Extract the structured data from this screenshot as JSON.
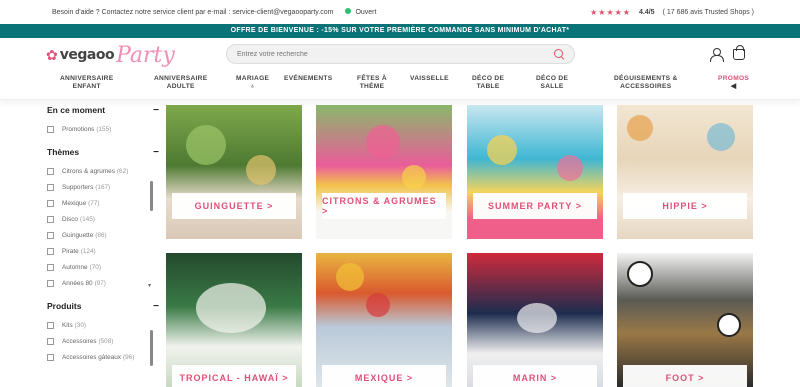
{
  "topbar": {
    "help_text": "Besoin d'aide ? Contactez notre service client par e-mail : service-client@vegaooparty.com",
    "status": "Ouvert",
    "stars": "★★★★★",
    "rating": "4.4/5",
    "rating_detail": "( 17 686 avis Trusted Shops )"
  },
  "promo_banner": "OFFRE DE BIENVENUE : -15% SUR VOTRE PREMIÈRE COMMANDE SANS MINIMUM D'ACHAT*",
  "logo": {
    "flower": "✿",
    "part1": "vegaoo",
    "part2": "Party"
  },
  "search": {
    "placeholder": "Entrez votre recherche"
  },
  "nav": [
    {
      "label": "ANNIVERSAIRE\nENFANT"
    },
    {
      "label": "ANNIVERSAIRE\nADULTE"
    },
    {
      "label": "MARIAGE"
    },
    {
      "label": "EVÉNEMENTS"
    },
    {
      "label": "FÊTES À\nTHÈME"
    },
    {
      "label": "VAISSELLE"
    },
    {
      "label": "DÉCO DE\nTABLE"
    },
    {
      "label": "DÉCO DE\nSALLE"
    },
    {
      "label": "DÉGUISEMENTS &\nACCESSOIRES"
    },
    {
      "label": "PROMOS"
    }
  ],
  "sidebar": {
    "sections": [
      {
        "title": "En ce moment",
        "items": [
          {
            "label": "Promotions",
            "count": "(155)"
          }
        ]
      },
      {
        "title": "Thèmes",
        "items": [
          {
            "label": "Citrons & agrumes",
            "count": "(62)"
          },
          {
            "label": "Supporters",
            "count": "(167)"
          },
          {
            "label": "Mexique",
            "count": "(77)"
          },
          {
            "label": "Disco",
            "count": "(145)"
          },
          {
            "label": "Guinguette",
            "count": "(86)"
          },
          {
            "label": "Pirate",
            "count": "(124)"
          },
          {
            "label": "Automne",
            "count": "(70)"
          },
          {
            "label": "Années 80",
            "count": "(97)"
          }
        ]
      },
      {
        "title": "Produits",
        "items": [
          {
            "label": "Kits",
            "count": "(30)"
          },
          {
            "label": "Accessoires",
            "count": "(508)"
          },
          {
            "label": "Accessoires gâteaux",
            "count": "(96)"
          }
        ]
      }
    ]
  },
  "cards": [
    {
      "label": "GUINGUETTE >"
    },
    {
      "label": "CITRONS & AGRUMES >"
    },
    {
      "label": "SUMMER PARTY >"
    },
    {
      "label": "HIPPIE >"
    },
    {
      "label": "TROPICAL - HAWAÏ >"
    },
    {
      "label": "MEXIQUE >"
    },
    {
      "label": "MARIN >"
    },
    {
      "label": "FOOT >"
    }
  ],
  "colors": {
    "accent": "#e0507a",
    "banner": "#0a7377"
  }
}
